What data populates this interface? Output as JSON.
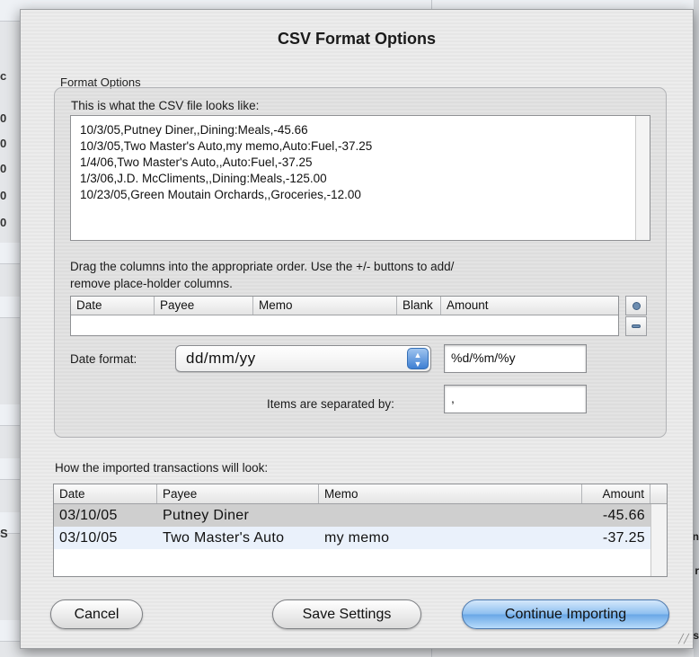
{
  "dialog": {
    "title": "CSV Format Options",
    "format_options_label": "Format Options",
    "preview_label": "This is what the CSV file looks like:",
    "preview_lines": [
      "10/3/05,Putney Diner,,Dining:Meals,-45.66",
      "10/3/05,Two Master's Auto,my memo,Auto:Fuel,-37.25",
      "1/4/06,Two Master's Auto,,Auto:Fuel,-37.25",
      "1/3/06,J.D. McCliments,,Dining:Meals,-125.00",
      "10/23/05,Green Moutain Orchards,,Groceries,-12.00"
    ],
    "drag_instruction_line1": "Drag the columns into the appropriate order.  Use the +/- buttons to add/",
    "drag_instruction_line2": "remove place-holder columns.",
    "columns": [
      "Date",
      "Payee",
      "Memo",
      "Blank",
      "Amount"
    ],
    "date_format_label": "Date format:",
    "date_format_value": "dd/mm/yy",
    "date_format_code": "%d/%m/%y",
    "separator_label": "Items are separated by:",
    "separator_value": ",",
    "imported_label": "How the imported transactions will look:",
    "imported_columns": [
      "Date",
      "Payee",
      "Memo",
      "Amount"
    ],
    "imported_rows": [
      {
        "date": "03/10/05",
        "payee": "Putney Diner",
        "memo": "",
        "amount": "-45.66"
      },
      {
        "date": "03/10/05",
        "payee": "Two Master's Auto",
        "memo": "my memo",
        "amount": "-37.25"
      }
    ],
    "buttons": {
      "cancel": "Cancel",
      "save": "Save Settings",
      "continue": "Continue Importing"
    }
  },
  "icons": {
    "add_column": "plus-circle-icon",
    "remove_column": "minus-icon",
    "popup_arrows": "updown-arrows-icon"
  },
  "background": {
    "left_digits": [
      "0",
      "0",
      "0",
      "0",
      "0"
    ],
    "left_letters": [
      "c",
      "S"
    ],
    "right_letters": [
      "n",
      "r",
      "s"
    ]
  },
  "colors": {
    "default_button": "#6aa8e6",
    "selected_row": "#cfcfcf",
    "alt_row": "#eaf1fb"
  }
}
